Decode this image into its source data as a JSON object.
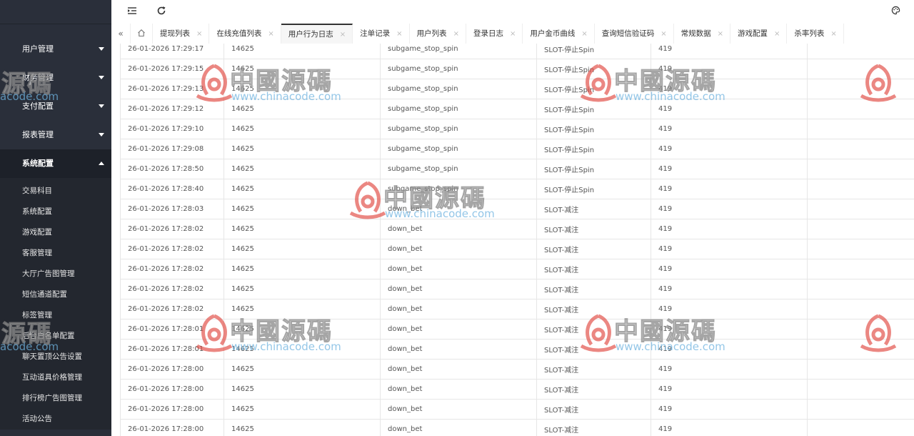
{
  "sidebar": {
    "groups": [
      {
        "label": "用户管理",
        "expanded": false
      },
      {
        "label": "财务管理",
        "expanded": false
      },
      {
        "label": "支付配置",
        "expanded": false
      },
      {
        "label": "报表管理",
        "expanded": false
      },
      {
        "label": "系统配置",
        "expanded": true
      }
    ],
    "sub_items": [
      {
        "label": "交易科目"
      },
      {
        "label": "系统配置"
      },
      {
        "label": "游戏配置"
      },
      {
        "label": "客服管理"
      },
      {
        "label": "大厅广告图管理"
      },
      {
        "label": "短信通道配置"
      },
      {
        "label": "标签管理"
      },
      {
        "label": "后台白名单配置"
      },
      {
        "label": "聊天置顶公告设置"
      },
      {
        "label": "互动道具价格管理"
      },
      {
        "label": "排行榜广告图管理"
      },
      {
        "label": "活动公告"
      }
    ]
  },
  "topbar": {
    "menu_toggle_icon": "menu-fold-icon",
    "refresh_icon": "refresh-icon",
    "theme_icon": "palette-icon"
  },
  "tabs": {
    "items": [
      {
        "label": "提现列表",
        "active": false
      },
      {
        "label": "在线充值列表",
        "active": false
      },
      {
        "label": "用户行为日志",
        "active": true
      },
      {
        "label": "注单记录",
        "active": false
      },
      {
        "label": "用户列表",
        "active": false
      },
      {
        "label": "登录日志",
        "active": false
      },
      {
        "label": "用户金币曲线",
        "active": false
      },
      {
        "label": "查询短信验证码",
        "active": false
      },
      {
        "label": "常规数据",
        "active": false
      },
      {
        "label": "游戏配置",
        "active": false
      },
      {
        "label": "杀率列表",
        "active": false
      }
    ],
    "close_glyph": "×"
  },
  "table": {
    "rows": [
      [
        "26-01-2026 17:29:17",
        "14625",
        "subgame_stop_spin",
        "SLOT-停止Spin",
        "419",
        ""
      ],
      [
        "26-01-2026 17:29:15",
        "14625",
        "subgame_stop_spin",
        "SLOT-停止Spin",
        "419",
        ""
      ],
      [
        "26-01-2026 17:29:13",
        "14625",
        "subgame_stop_spin",
        "SLOT-停止Spin",
        "419",
        ""
      ],
      [
        "26-01-2026 17:29:12",
        "14625",
        "subgame_stop_spin",
        "SLOT-停止Spin",
        "419",
        ""
      ],
      [
        "26-01-2026 17:29:10",
        "14625",
        "subgame_stop_spin",
        "SLOT-停止Spin",
        "419",
        ""
      ],
      [
        "26-01-2026 17:29:08",
        "14625",
        "subgame_stop_spin",
        "SLOT-停止Spin",
        "419",
        ""
      ],
      [
        "26-01-2026 17:28:50",
        "14625",
        "subgame_stop_spin",
        "SLOT-停止Spin",
        "419",
        ""
      ],
      [
        "26-01-2026 17:28:40",
        "14625",
        "subgame_stop_spin",
        "SLOT-停止Spin",
        "419",
        ""
      ],
      [
        "26-01-2026 17:28:03",
        "14625",
        "down_bet",
        "SLOT-减注",
        "419",
        ""
      ],
      [
        "26-01-2026 17:28:02",
        "14625",
        "down_bet",
        "SLOT-减注",
        "419",
        ""
      ],
      [
        "26-01-2026 17:28:02",
        "14625",
        "down_bet",
        "SLOT-减注",
        "419",
        ""
      ],
      [
        "26-01-2026 17:28:02",
        "14625",
        "down_bet",
        "SLOT-减注",
        "419",
        ""
      ],
      [
        "26-01-2026 17:28:02",
        "14625",
        "down_bet",
        "SLOT-减注",
        "419",
        ""
      ],
      [
        "26-01-2026 17:28:02",
        "14625",
        "down_bet",
        "SLOT-减注",
        "419",
        ""
      ],
      [
        "26-01-2026 17:28:01",
        "14625",
        "down_bet",
        "SLOT-减注",
        "419",
        ""
      ],
      [
        "26-01-2026 17:28:01",
        "14625",
        "down_bet",
        "SLOT-减注",
        "419",
        ""
      ],
      [
        "26-01-2026 17:28:00",
        "14625",
        "down_bet",
        "SLOT-减注",
        "419",
        ""
      ],
      [
        "26-01-2026 17:28:00",
        "14625",
        "down_bet",
        "SLOT-减注",
        "419",
        ""
      ],
      [
        "26-01-2026 17:28:00",
        "14625",
        "down_bet",
        "SLOT-减注",
        "419",
        ""
      ],
      [
        "26-01-2026 17:28:00",
        "14625",
        "down_bet",
        "SLOT-减注",
        "419",
        ""
      ]
    ]
  },
  "watermark": {
    "cn_text": "中國源碼",
    "url_text": "www.chinacode.com",
    "side_text": "源碼",
    "side_url": "acode.com",
    "mark_color": "#e0443c"
  }
}
